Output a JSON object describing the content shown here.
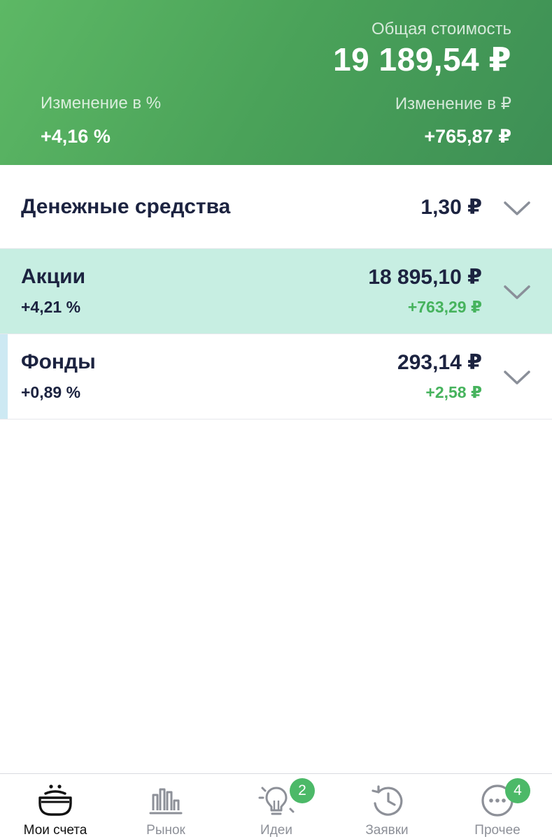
{
  "header": {
    "total_label": "Общая стоимость",
    "total_value": "19 189,54 ₽",
    "change_pct_label": "Изменение в %",
    "change_pct_value": "+4,16 %",
    "change_rub_label": "Изменение в ₽",
    "change_rub_value": "+765,87 ₽"
  },
  "portfolio": {
    "cash": {
      "title": "Денежные средства",
      "amount": "1,30 ₽"
    },
    "stocks": {
      "title": "Акции",
      "change_pct": "+4,21 %",
      "amount": "18 895,10 ₽",
      "gain": "+763,29 ₽"
    },
    "funds": {
      "title": "Фонды",
      "change_pct": "+0,89 %",
      "amount": "293,14 ₽",
      "gain": "+2,58 ₽"
    }
  },
  "tabbar": {
    "tabs": [
      {
        "label": "Мои счета",
        "icon": "wallet-icon",
        "active": true
      },
      {
        "label": "Рынок",
        "icon": "market-chart-icon",
        "active": false
      },
      {
        "label": "Идеи",
        "icon": "lightbulb-icon",
        "badge": "2",
        "active": false
      },
      {
        "label": "Заявки",
        "icon": "history-clock-icon",
        "active": false
      },
      {
        "label": "Прочее",
        "icon": "more-dots-icon",
        "badge": "4",
        "active": false
      }
    ]
  },
  "colors": {
    "header_green": "#4aa259",
    "gain_green": "#46b35d",
    "selected_row": "#c7eee2",
    "badge_green": "#4cb968",
    "text_dark": "#1c2340"
  }
}
